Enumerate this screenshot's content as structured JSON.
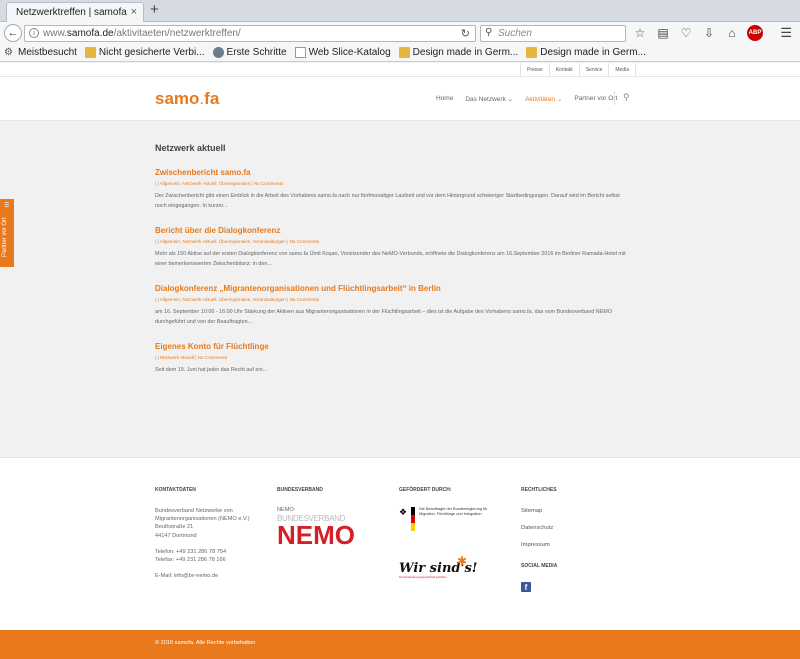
{
  "browser": {
    "tab_title": "Netzwerktreffen | samofa",
    "tab_close": "×",
    "new_tab": "+",
    "url_prefix": "www.",
    "url_domain": "samofa.de",
    "url_path": "/aktivitaeten/netzwerktreffen/",
    "search_placeholder": "Suchen",
    "icons": [
      "back-icon",
      "info-icon",
      "reload-icon",
      "search-icon",
      "bookmark-star-icon",
      "reader-icon",
      "pocket-icon",
      "download-icon",
      "home-icon",
      "adblock-icon",
      "menu-icon"
    ],
    "abp_label": "ABP"
  },
  "bookmarks": [
    {
      "label": "Meistbesucht",
      "icon": "gear-icon"
    },
    {
      "label": "Nicht gesicherte Verbi...",
      "icon": "folder-icon"
    },
    {
      "label": "Erste Schritte",
      "icon": "globe-icon"
    },
    {
      "label": "Web Slice-Katalog",
      "icon": "page-icon"
    },
    {
      "label": "Design made in Germ...",
      "icon": "folder-icon"
    },
    {
      "label": "Design made in Germ...",
      "icon": "folder-icon"
    }
  ],
  "site": {
    "toplinks": [
      "Presse",
      "Kontakt",
      "Service",
      "Media"
    ],
    "logo_main": "samo",
    "logo_dot": ".",
    "logo_end": "fa",
    "nav": [
      {
        "label": "Home",
        "active": false
      },
      {
        "label": "Das Netzwerk ⌄",
        "active": false
      },
      {
        "label": "Aktivitäten ⌄",
        "active": true
      },
      {
        "label": "Partner vor Ort",
        "active": false
      }
    ],
    "sidetab_label": "Partner vor Ort",
    "accent_color": "#e87a1d"
  },
  "content": {
    "section_title": "Netzwerk aktuell",
    "posts": [
      {
        "title": "Zwischenbericht samo.fa",
        "meta": "| | Allgemein, Netzwerk Aktuell, Überregionales | No Comments",
        "excerpt": "Der Zwischenbericht gibt einen Einblick in die Arbeit des Vorhabens samo.fa nach nur fünfmonatiger Laufzeit und vor dem Hintergrund schwieriger Startbedingungen. Darauf wird im Bericht selbst noch eingegangen. In kurzer..."
      },
      {
        "title": "Bericht über die Dialogkonferenz",
        "meta": "| | Allgemein, Netzwerk Aktuell, Überregionales, Veranstaltungen | No Comments",
        "excerpt": "Mehr als 150 Aktive auf der ersten Dialogkonferenz von samo.fa Ümit Koşan, Vorsitzender des NeMO-Verbunds, eröffnete die Dialogkonferenz am 16.September 2016 im Berliner Ramada-Hotel mit einer bemerkenswerten Zwischenbilanz: in den..."
      },
      {
        "title": "Dialogkonferenz „Migrantenorganisationen und Flüchtlingsarbeit“ in Berlin",
        "meta": "| | Allgemein, Netzwerk Aktuell, Überregionales, Veranstaltungen | No Comments",
        "excerpt": "am 16. September 10:00 - 16:00 Uhr Stärkung der Aktiven aus Migrantenorganisationen in der Flüchtlingsarbeit – dies ist die Aufgabe des Vorhabens samo.fa, das vom Bundesverband NEMO durchgeführt und von der Beauftragten..."
      },
      {
        "title": "Eigenes Konto für Flüchtlinge",
        "meta": "| | Netzwerk Aktuell | No Comments",
        "excerpt": "Seit dem 19. Juni hat jeder das Recht auf ein..."
      }
    ]
  },
  "footer": {
    "kontakt": {
      "heading": "KONTAKTDATEN",
      "line1": "Bundesverband Netzwerke von",
      "line2": "Migrantenorganisationen (NEMO e.V.)",
      "line3": "Beuthstraße 21",
      "line4": "44147 Dortmund",
      "phone": "Telefon: +49 231 286 78 754",
      "fax": "Telefax: +49 231 286 78 166",
      "email": "E-Mail: info@bv-nemo.de"
    },
    "bundesverband": {
      "heading": "BUNDESVERBAND",
      "label": "NEMO:",
      "logo_thin": "BUNDESVERBAND",
      "logo_big": "NEMO"
    },
    "gefoerdert": {
      "heading": "GEFÖRDERT DURCH:",
      "logo1_text": "Die Beauftragte der Bundesregierung für Migration, Flüchtlinge und Integration",
      "logo2_text": "Wir sind's!",
      "logo2_sub": "Die Einwanderungsgesellschaft gestalten"
    },
    "rechtliches": {
      "heading": "RECHTLICHES",
      "links": [
        "Sitemap",
        "Datenschutz",
        "Impressum"
      ],
      "social_heading": "SOCIAL MEDIA",
      "facebook": "f"
    },
    "copyright": "© 2016 samofa. Alle Rechte vorbehalten"
  }
}
